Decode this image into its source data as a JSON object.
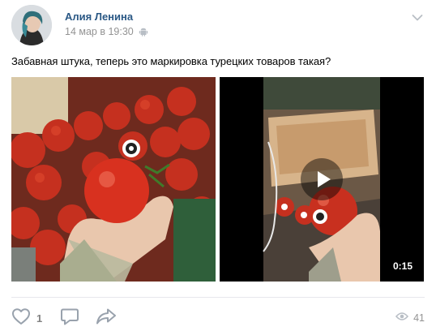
{
  "post": {
    "author": "Алия Ленина",
    "date": "14 мар в 19:30",
    "text": "Забавная штука, теперь это маркировка турецких товаров такая?",
    "video_duration": "0:15"
  },
  "footer": {
    "likes": "1",
    "views": "41"
  },
  "icons": {
    "platform": "android-icon",
    "menu": "chevron-down-icon",
    "like": "heart-icon",
    "comment": "comment-icon",
    "share": "share-icon",
    "views": "eye-icon",
    "play": "play-icon"
  },
  "colors": {
    "author_link": "#2a5885",
    "muted": "#939393",
    "icon": "#99a2ad"
  }
}
